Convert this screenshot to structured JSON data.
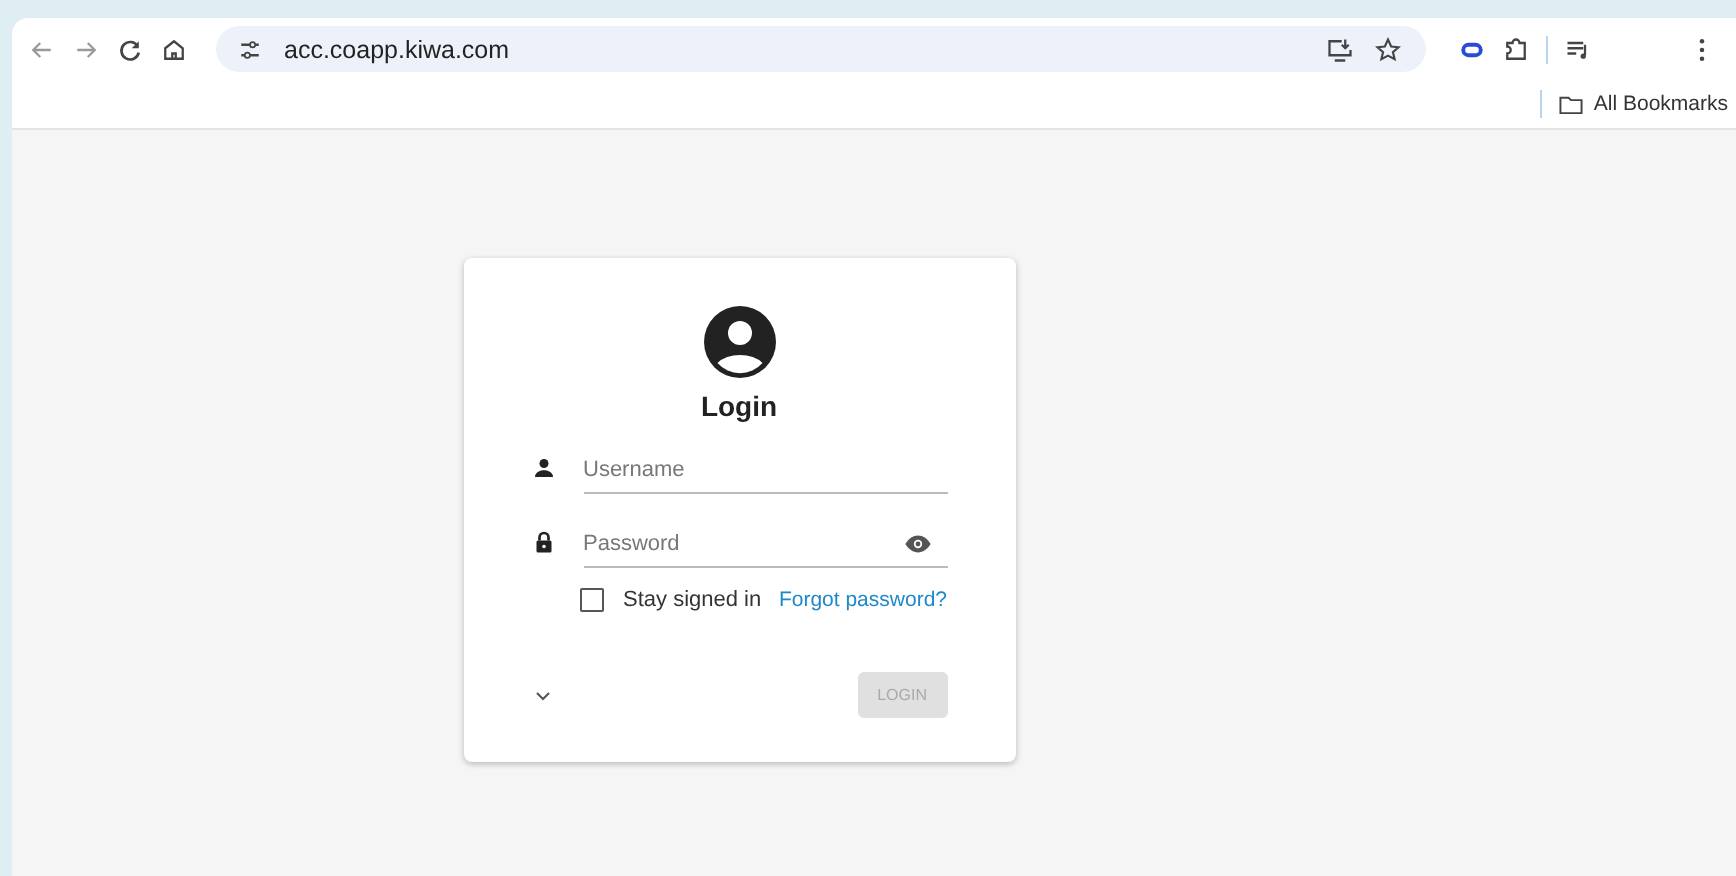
{
  "browser": {
    "url": "acc.coapp.kiwa.com",
    "bookmarks_label": "All Bookmarks"
  },
  "login": {
    "title": "Login",
    "fields": [
      {
        "kind": "text",
        "placeholder": "Username"
      },
      {
        "kind": "password",
        "placeholder": "Password"
      }
    ],
    "stay_signed_in": {
      "label": "Stay signed in",
      "checked": false
    },
    "forgot_link": "Forgot password?",
    "login_button": {
      "label": "LOGIN",
      "disabled": true
    }
  }
}
